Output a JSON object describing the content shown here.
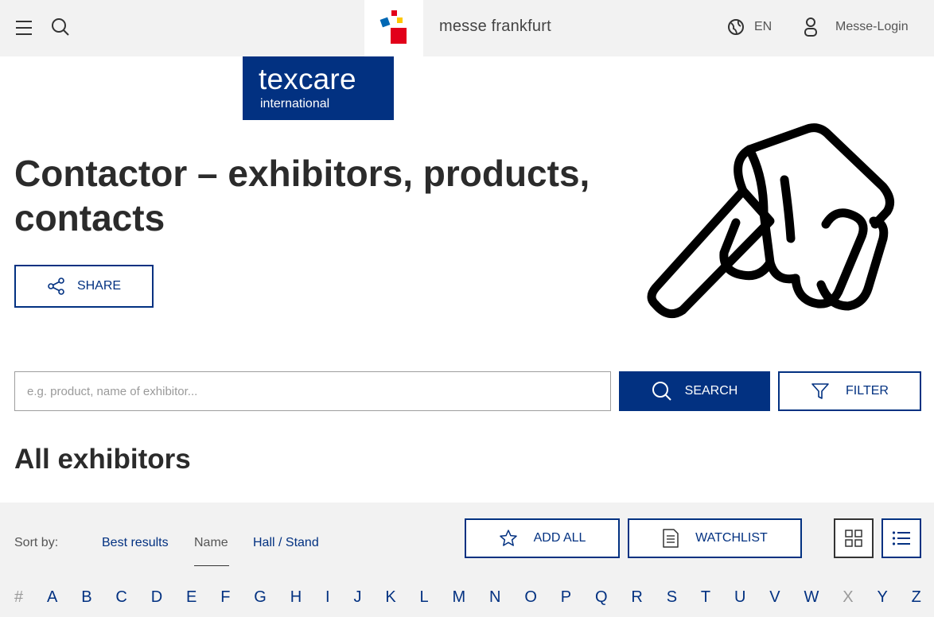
{
  "header": {
    "brand": "messe frankfurt",
    "language": "EN",
    "login_label": "Messe-Login"
  },
  "event_logo": {
    "line1": "texcare",
    "line2": "international"
  },
  "page": {
    "title": "Contactor – exhibitors, products, contacts",
    "share_label": "SHARE"
  },
  "search": {
    "placeholder": "e.g. product, name of exhibitor...",
    "button_label": "SEARCH",
    "filter_label": "FILTER"
  },
  "listing": {
    "title": "All exhibitors",
    "sort_label": "Sort by:",
    "sort_options": [
      "Best results",
      "Name",
      "Hall / Stand"
    ],
    "sort_active": "Name",
    "add_all_label": "ADD ALL",
    "watchlist_label": "WATCHLIST",
    "letters": [
      "#",
      "A",
      "B",
      "C",
      "D",
      "E",
      "F",
      "G",
      "H",
      "I",
      "J",
      "K",
      "L",
      "M",
      "N",
      "O",
      "P",
      "Q",
      "R",
      "S",
      "T",
      "U",
      "V",
      "W",
      "X",
      "Y",
      "Z"
    ],
    "disabled_letters": [
      "#",
      "X"
    ]
  },
  "colors": {
    "brand_blue": "#023181",
    "logo_red": "#e2001a",
    "logo_blue": "#0068b4",
    "logo_yellow": "#ffc800"
  }
}
